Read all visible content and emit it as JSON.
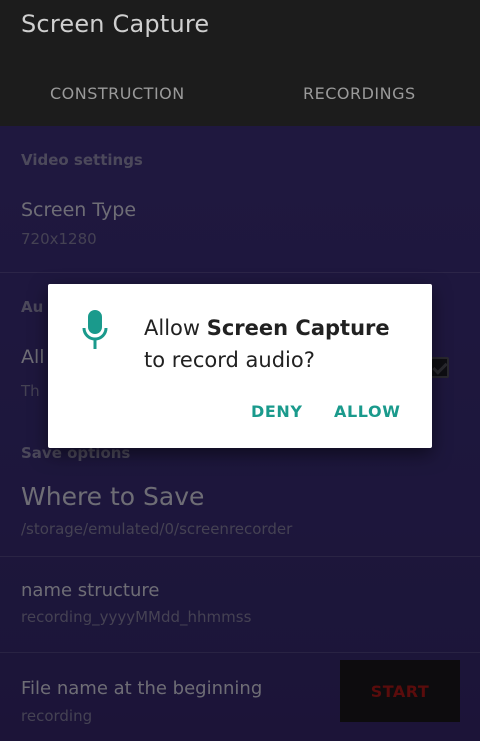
{
  "app": {
    "title": "Screen Capture"
  },
  "tabs": [
    {
      "label": "CONSTRUCTION"
    },
    {
      "label": "RECORDINGS"
    }
  ],
  "video_settings": {
    "header": "Video settings",
    "screen_type": {
      "title": "Screen Type",
      "value": "720x1280"
    }
  },
  "audio_settings": {
    "header_partial": "Au",
    "allow_title_partial": "All",
    "allow_sub_partial": "Th",
    "checkbox_checked": true
  },
  "save_options": {
    "header": "Save options",
    "where_to_save": {
      "title": "Where to Save",
      "value": "/storage/emulated/0/screenrecorder"
    },
    "name_structure": {
      "title": "name structure",
      "value": "recording_yyyyMMdd_hhmmss"
    },
    "file_name_beginning": {
      "title": "File name at the beginning",
      "value": "recording"
    }
  },
  "start_button": {
    "label": "START"
  },
  "dialog": {
    "icon": "microphone-icon",
    "text_prefix": "Allow ",
    "app_name": "Screen Capture",
    "text_suffix": "to record audio?",
    "deny_label": "DENY",
    "allow_label": "ALLOW",
    "accent_color": "#1a9a8c"
  }
}
